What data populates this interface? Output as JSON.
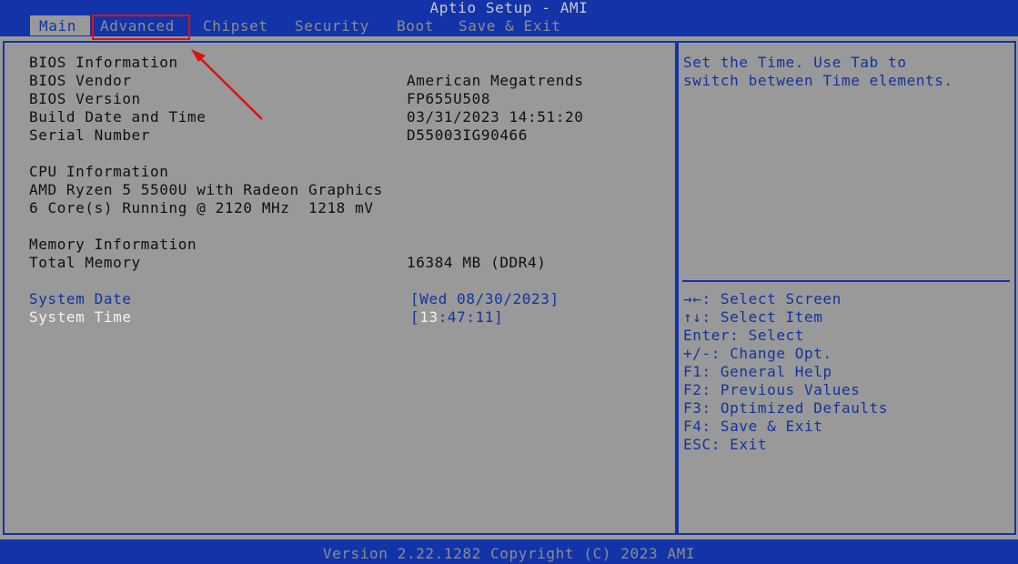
{
  "title": "Aptio Setup - AMI",
  "tabs": [
    "Main",
    "Advanced",
    "Chipset",
    "Security",
    "Boot",
    "Save & Exit"
  ],
  "main": {
    "bios_info_heading": "BIOS Information",
    "bios_vendor_label": "BIOS Vendor",
    "bios_vendor_value": "American Megatrends",
    "bios_version_label": "BIOS Version",
    "bios_version_value": "FP655U508",
    "build_date_label": "Build Date and Time",
    "build_date_value": "03/31/2023 14:51:20",
    "serial_label": "Serial Number",
    "serial_value": "D55003IG90466",
    "cpu_heading": "CPU Information",
    "cpu_model": "AMD Ryzen 5 5500U with Radeon Graphics",
    "cpu_status": "6 Core(s) Running @ 2120 MHz  1218 mV",
    "memory_heading": "Memory Information",
    "total_memory_label": "Total Memory",
    "total_memory_value": "16384 MB (DDR4)",
    "system_date_label": "System Date",
    "system_date_value": "[Wed 08/30/2023]",
    "system_time_label": "System Time",
    "system_time_prefix": "[",
    "system_time_hours": "13",
    "system_time_rest": ":47:11]"
  },
  "help": {
    "line1": "Set the Time. Use Tab to",
    "line2": "switch between Time elements."
  },
  "keys": [
    "→←: Select Screen",
    "↑↓: Select Item",
    "Enter: Select",
    "+/-: Change Opt.",
    "F1: General Help",
    "F2: Previous Values",
    "F3: Optimized Defaults",
    "F4: Save & Exit",
    "ESC: Exit"
  ],
  "footer": "Version 2.22.1282 Copyright (C) 2023 AMI",
  "colors": {
    "background_blue": "#1234a8",
    "panel_gray": "#999999",
    "highlight_red": "#e01010"
  }
}
